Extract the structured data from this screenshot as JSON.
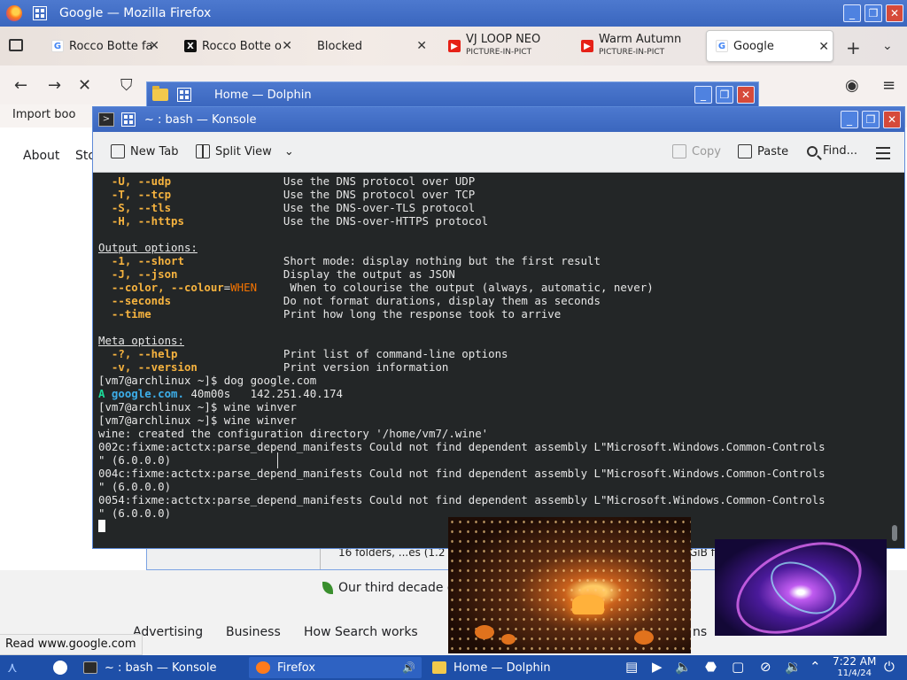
{
  "firefox": {
    "window_title": "Google — Mozilla Firefox",
    "tabs": [
      {
        "label": "Rocco Botte fa",
        "icon": "google-icon"
      },
      {
        "label": "Rocco Botte o",
        "icon": "x-logo-icon"
      },
      {
        "label": "Blocked",
        "icon": ""
      },
      {
        "label": "VJ LOOP NEO",
        "sublabel": "PICTURE-IN-PICT",
        "icon": "youtube-icon"
      },
      {
        "label": "Warm Autumn",
        "sublabel": "PICTURE-IN-PICT",
        "icon": "youtube-icon"
      },
      {
        "label": "Google",
        "icon": "google-icon",
        "active": true
      }
    ],
    "bookmarks_label": "Import boo",
    "page": {
      "nav_about": "About",
      "nav_store": "Sto",
      "footer_tagline": "Our third decade o",
      "footer_links": [
        "Advertising",
        "Business",
        "How Search works"
      ],
      "footer_right": "ns"
    },
    "status_url": "Read www.google.com"
  },
  "dolphin": {
    "window_title": "Home — Dolphin",
    "status_text": "16 folders, ...es (1.2",
    "status_free": "GiB fr"
  },
  "konsole": {
    "window_title": "~ : bash — Konsole",
    "toolbar": {
      "new_tab": "New Tab",
      "split_view": "Split View",
      "copy": "Copy",
      "paste": "Paste",
      "find": "Find..."
    }
  },
  "terminal_lines": [
    [
      {
        "c": "y",
        "t": "  -U, --udp"
      },
      {
        "c": "",
        "t": "                 Use the DNS protocol over UDP"
      }
    ],
    [
      {
        "c": "y",
        "t": "  -T, --tcp"
      },
      {
        "c": "",
        "t": "                 Use the DNS protocol over TCP"
      }
    ],
    [
      {
        "c": "y",
        "t": "  -S, --tls"
      },
      {
        "c": "",
        "t": "                 Use the DNS-over-TLS protocol"
      }
    ],
    [
      {
        "c": "y",
        "t": "  -H, --https"
      },
      {
        "c": "",
        "t": "               Use the DNS-over-HTTPS protocol"
      }
    ],
    [],
    [
      {
        "c": "u",
        "t": "Output options:"
      }
    ],
    [
      {
        "c": "y",
        "t": "  -1, --short"
      },
      {
        "c": "",
        "t": "               Short mode: display nothing but the first result"
      }
    ],
    [
      {
        "c": "y",
        "t": "  -J, --json"
      },
      {
        "c": "",
        "t": "                Display the output as JSON"
      }
    ],
    [
      {
        "c": "y",
        "t": "  --color, --colour"
      },
      {
        "c": "",
        "t": "="
      },
      {
        "c": "o",
        "t": "WHEN"
      },
      {
        "c": "",
        "t": "     When to colourise the output (always, automatic, never)"
      }
    ],
    [
      {
        "c": "y",
        "t": "  --seconds"
      },
      {
        "c": "",
        "t": "                 Do not format durations, display them as seconds"
      }
    ],
    [
      {
        "c": "y",
        "t": "  --time"
      },
      {
        "c": "",
        "t": "                    Print how long the response took to arrive"
      }
    ],
    [],
    [
      {
        "c": "u",
        "t": "Meta options:"
      }
    ],
    [
      {
        "c": "y",
        "t": "  -?, --help"
      },
      {
        "c": "",
        "t": "                Print list of command-line options"
      }
    ],
    [
      {
        "c": "y",
        "t": "  -v, --version"
      },
      {
        "c": "",
        "t": "             Print version information"
      }
    ],
    [
      {
        "c": "",
        "t": "[vm7@archlinux ~]$ dog google.com"
      }
    ],
    [
      {
        "c": "g",
        "t": "A "
      },
      {
        "c": "b",
        "t": "google.com."
      },
      {
        "c": "",
        "t": " 40m00s   142.251.40.174"
      }
    ],
    [
      {
        "c": "",
        "t": "[vm7@archlinux ~]$ wine winver"
      }
    ],
    [
      {
        "c": "",
        "t": "[vm7@archlinux ~]$ wine winver"
      }
    ],
    [
      {
        "c": "",
        "t": "wine: created the configuration directory '/home/vm7/.wine'"
      }
    ],
    [
      {
        "c": "",
        "t": "002c:fixme:actctx:parse_depend_manifests Could not find dependent assembly L\"Microsoft.Windows.Common-Controls"
      }
    ],
    [
      {
        "c": "",
        "t": "\" (6.0.0.0)"
      }
    ],
    [
      {
        "c": "",
        "t": "004c:fixme:actctx:parse_depend_manifests Could not find dependent assembly L\"Microsoft.Windows.Common-Controls"
      }
    ],
    [
      {
        "c": "",
        "t": "\" (6.0.0.0)"
      }
    ],
    [
      {
        "c": "",
        "t": "0054:fixme:actctx:parse_depend_manifests Could not find dependent assembly L\"Microsoft.Windows.Common-Controls"
      }
    ],
    [
      {
        "c": "",
        "t": "\" (6.0.0.0)"
      }
    ]
  ],
  "taskbar": {
    "tasks": [
      {
        "label": "~ : bash — Konsole",
        "icon": "terminal-icon",
        "color": "#2b2b2b"
      },
      {
        "label": "Firefox",
        "icon": "firefox-icon",
        "color": "#ff7b1c",
        "active": true
      },
      {
        "label": "Home — Dolphin",
        "icon": "folder-icon",
        "color": "#f2c94c"
      }
    ],
    "clock_time": "7:22 AM",
    "clock_date": "11/4/24"
  },
  "colors": {
    "titlebar": "#3a66be",
    "terminal_bg": "#232627",
    "terminal_option": "#f6b33f",
    "terminal_value": "#f67400",
    "terminal_domain": "#3daee9",
    "taskbar": "#1e4fa8"
  }
}
